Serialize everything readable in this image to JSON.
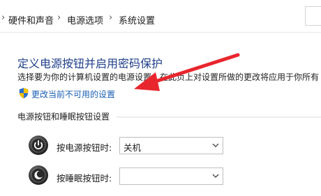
{
  "breadcrumb": {
    "items": [
      "硬件和声音",
      "电源选项",
      "系统设置"
    ],
    "separator": "›"
  },
  "page": {
    "title": "定义电源按钮并启用密码保护",
    "description": "选择要为你的计算机设置的电源设置。在此页上对设置所做的更改将应用于你所有",
    "change_link": "更改当前不可用的设置"
  },
  "section": {
    "label": "电源按钮和睡眠按钮设置"
  },
  "rows": [
    {
      "label": "按电源按钮时:",
      "value": "关机",
      "icon": "power-button-icon"
    },
    {
      "label": "按睡眠按钮时:",
      "value": "",
      "icon": "sleep-button-icon"
    }
  ],
  "colors": {
    "title": "#1f3f8a",
    "link": "#1a5fb4",
    "annotation_arrow": "#e8262d"
  }
}
